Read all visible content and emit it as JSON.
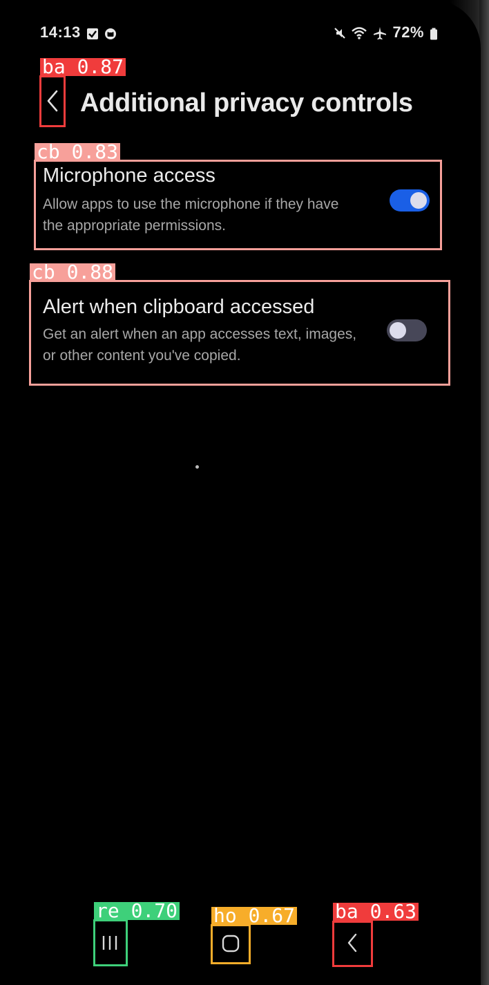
{
  "status_bar": {
    "time": "14:13",
    "battery": "72%",
    "icons": [
      "checkbox-notification-icon",
      "app-notification-icon",
      "mute-icon",
      "wifi-icon",
      "airplane-icon",
      "battery-icon"
    ]
  },
  "header": {
    "title": "Additional privacy controls",
    "back_icon": "chevron-left-icon"
  },
  "settings": [
    {
      "title": "Microphone access",
      "description": "Allow apps to use the microphone if they have the appropriate permissions.",
      "enabled": true
    },
    {
      "title": "Alert when clipboard accessed",
      "description": "Get an alert when an app accesses text, images, or other content you've copied.",
      "enabled": false
    }
  ],
  "navigation_bar": {
    "recents_icon": "recents-icon",
    "home_icon": "home-icon",
    "back_icon": "back-icon"
  },
  "detections": [
    {
      "label": "ba 0.87",
      "color": "#f03c3c"
    },
    {
      "label": "cb 0.83",
      "color": "#f7a09a"
    },
    {
      "label": "cb 0.88",
      "color": "#f7a09a"
    },
    {
      "label": "re 0.70",
      "color": "#3ed07a"
    },
    {
      "label": "ho 0.67",
      "color": "#f7ad2a"
    },
    {
      "label": "ba 0.63",
      "color": "#f03c3c"
    }
  ],
  "colors": {
    "toggle_on": "#1a5fe6",
    "toggle_off": "#474758",
    "background": "#000000"
  }
}
